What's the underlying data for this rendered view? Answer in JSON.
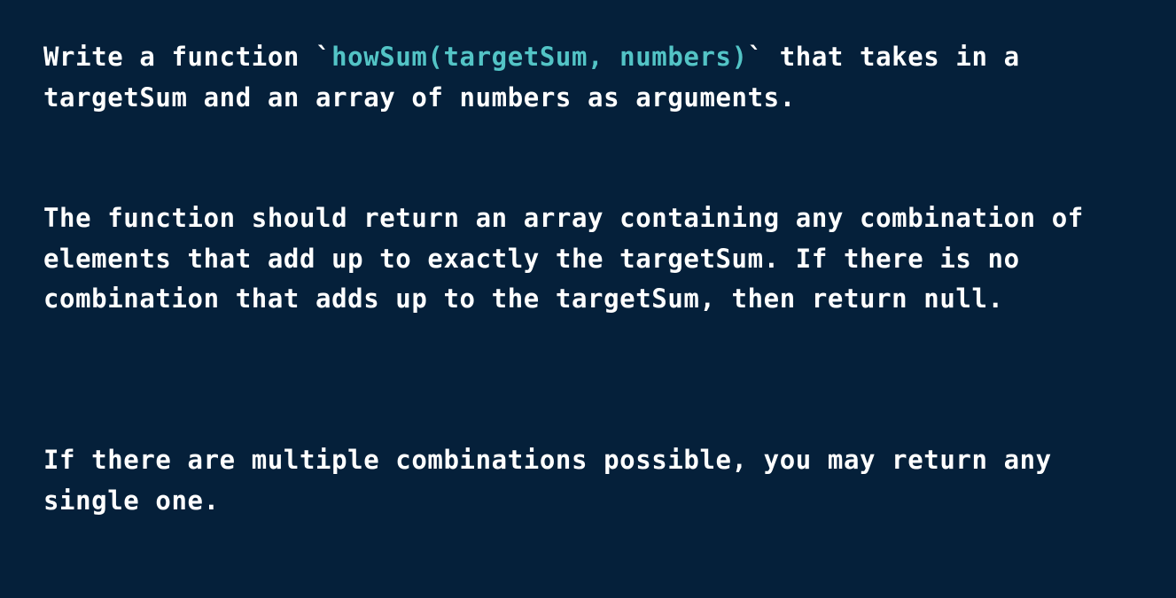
{
  "colors": {
    "background": "#05203a",
    "text": "#ffffff",
    "accent": "#53c4c6"
  },
  "paragraph_1": {
    "line_1_before": "Write a function `",
    "line_1_code": "howSum(targetSum, numbers)",
    "line_1_after": "` that takes in a",
    "line_2": "targetSum and an array of numbers as arguments."
  },
  "paragraph_2": {
    "line_1": "The function should return an array containing any combination of",
    "line_2": "elements that add up to exactly the targetSum. If there is no",
    "line_3": "combination that adds up to the targetSum, then return null."
  },
  "paragraph_3": {
    "line_1": "If there are multiple combinations possible, you may return any",
    "line_2": "single one."
  }
}
